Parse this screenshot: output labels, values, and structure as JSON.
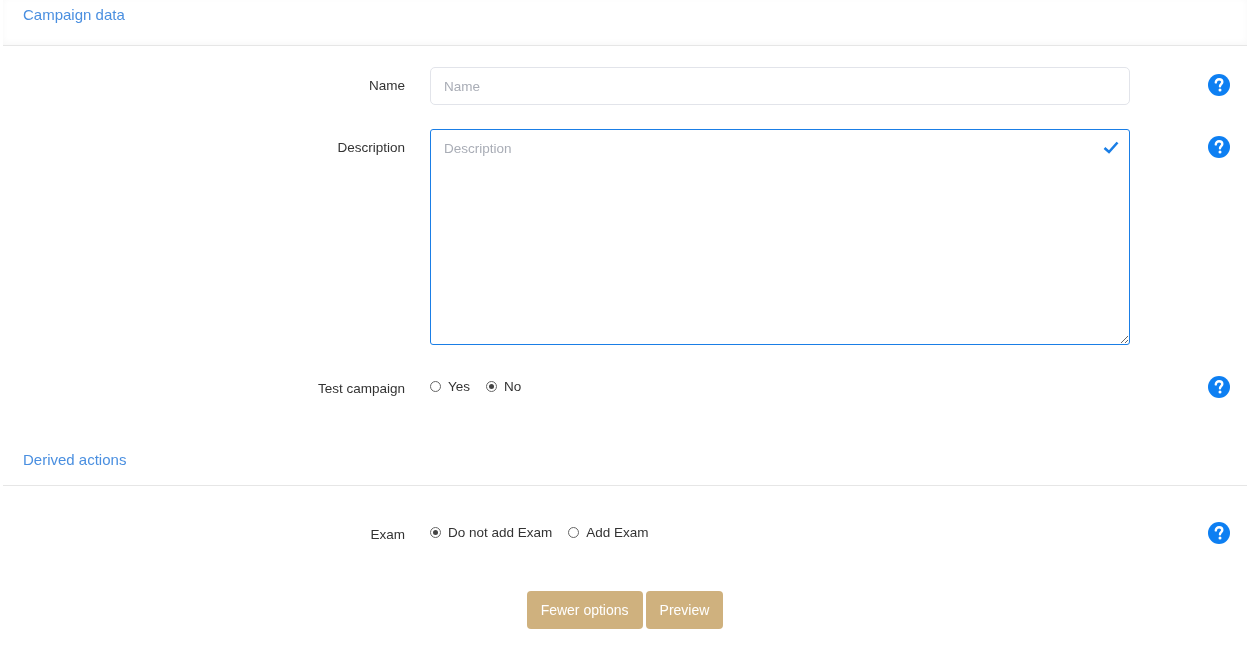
{
  "sections": [
    {
      "title": "Campaign data",
      "fields": [
        {
          "kind": "text",
          "label": "Name",
          "placeholder": "Name",
          "valid": false
        },
        {
          "kind": "textarea",
          "label": "Description",
          "placeholder": "Description",
          "valid": true
        },
        {
          "kind": "radio",
          "label": "Test campaign",
          "options": [
            {
              "label": "Yes",
              "selected": false
            },
            {
              "label": "No",
              "selected": true
            }
          ]
        }
      ]
    },
    {
      "title": "Derived actions",
      "fields": [
        {
          "kind": "radio",
          "label": "Exam",
          "options": [
            {
              "label": "Do not add Exam",
              "selected": true
            },
            {
              "label": "Add Exam",
              "selected": false
            }
          ]
        }
      ]
    }
  ],
  "buttons": [
    "Fewer options",
    "Preview"
  ]
}
